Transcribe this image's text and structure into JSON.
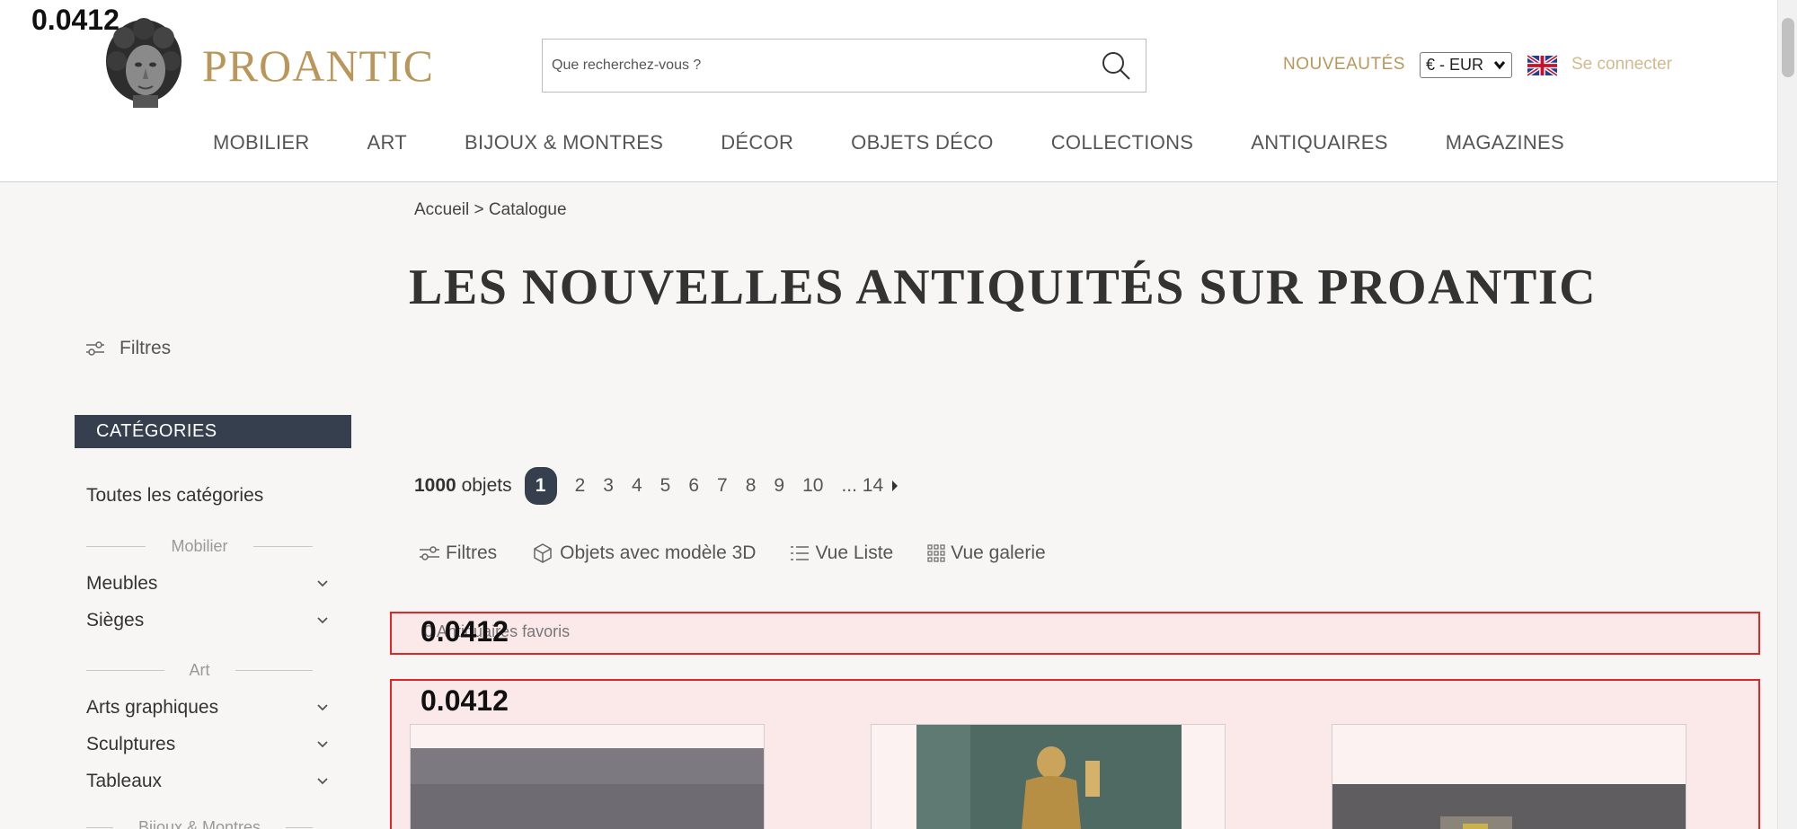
{
  "overlay": {
    "score": "0.0412"
  },
  "brand": {
    "name": "PROANTIC"
  },
  "search": {
    "placeholder": "Que recherchez-vous ?"
  },
  "header": {
    "new_label": "NOUVEAUTÉS",
    "currency": "€ - EUR",
    "login": "Se connecter"
  },
  "nav": [
    "MOBILIER",
    "ART",
    "BIJOUX & MONTRES",
    "DÉCOR",
    "OBJETS DÉCO",
    "COLLECTIONS",
    "ANTIQUAIRES",
    "MAGAZINES"
  ],
  "breadcrumb": {
    "home": "Accueil",
    "sep": ">",
    "current": "Catalogue"
  },
  "page": {
    "title": "LES NOUVELLES ANTIQUITÉS SUR PROANTIC"
  },
  "sidebar": {
    "filters_label": "Filtres",
    "categories_header": "CATÉGORIES",
    "all_categories": "Toutes les catégories",
    "groups": [
      {
        "title": "Mobilier",
        "items": [
          "Meubles",
          "Sièges"
        ]
      },
      {
        "title": "Art",
        "items": [
          "Arts graphiques",
          "Sculptures",
          "Tableaux"
        ]
      },
      {
        "title": "Bijoux & Montres",
        "items": []
      }
    ]
  },
  "pagination": {
    "count": "1000",
    "count_label": "objets",
    "pages": [
      "1",
      "2",
      "3",
      "4",
      "5",
      "6",
      "7",
      "8",
      "9",
      "10"
    ],
    "active": "1",
    "ellipsis_last": "... 14"
  },
  "toolbar": {
    "filters": "Filtres",
    "objects_3d": "Objets avec modèle 3D",
    "list_view": "Vue Liste",
    "gallery_view": "Vue galerie"
  },
  "favorites": {
    "text": "0 Antiquaires favoris"
  },
  "colors": {
    "gold": "#b9975b",
    "navy": "#363f4e",
    "highlight_border": "#e02626"
  }
}
